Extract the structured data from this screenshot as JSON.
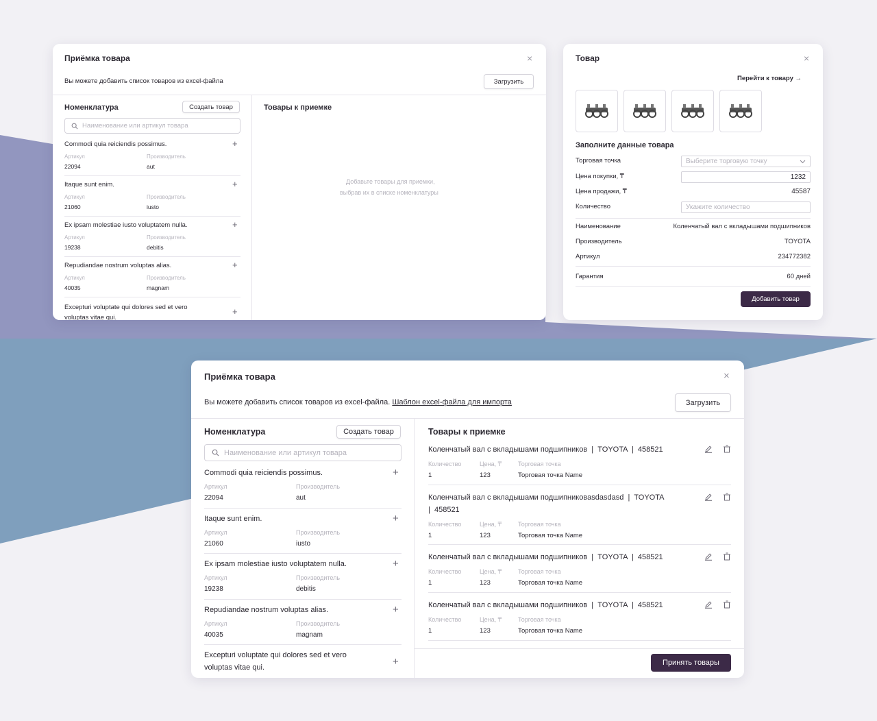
{
  "colors": {
    "background": "#f2f1f5",
    "band_purple": "#9296bf",
    "band_blue": "#7f9fbd",
    "accent": "#3c2a47"
  },
  "modal_small": {
    "title": "Приёмка товара",
    "close": "×",
    "upload_text": "Вы можете добавить список товаров из excel-файла",
    "upload_button": "Загрузить",
    "nomenclature": {
      "title": "Номенклатура",
      "create_button": "Создать товар",
      "search_placeholder": "Наименование или артикул товара",
      "article_label": "Артикул",
      "maker_label": "Производитель",
      "items": [
        {
          "name": "Commodi quia reiciendis possimus.",
          "article": "22094",
          "maker": "aut"
        },
        {
          "name": "Itaque sunt enim.",
          "article": "21060",
          "maker": "iusto"
        },
        {
          "name": "Ex ipsam molestiae iusto voluptatem nulla.",
          "article": "19238",
          "maker": "debitis"
        },
        {
          "name": "Repudiandae nostrum voluptas alias.",
          "article": "40035",
          "maker": "magnam"
        },
        {
          "name": "Excepturi voluptate qui dolores sed et vero voluptas vitae qui."
        }
      ]
    },
    "accept": {
      "title": "Товары к приемке",
      "empty_line1": "Добавьте товары для приемки,",
      "empty_line2": "выбрав их в списке номенклатуры"
    }
  },
  "product_modal": {
    "title": "Товар",
    "close": "×",
    "go_link": "Перейти к товару",
    "go_arrow": "→",
    "thumbnails": [
      "engine-part-image",
      "engine-part-image",
      "engine-part-image",
      "engine-part-image"
    ],
    "form_title": "Заполните данные товара",
    "fields": {
      "point_label": "Торговая точка",
      "point_placeholder": "Выберите торговую точку",
      "buy_label": "Цена покупки, ₸",
      "buy_value": "1232",
      "sell_label": "Цена продажи, ₸",
      "sell_value": "45587",
      "qty_label": "Количество",
      "qty_placeholder": "Укажите количество"
    },
    "info": {
      "name_label": "Наименование",
      "name_value": "Коленчатый вал с вкладышами подшипников",
      "maker_label": "Производитель",
      "maker_value": "TOYOTA",
      "article_label": "Артикул",
      "article_value": "234772382",
      "warranty_label": "Гарантия",
      "warranty_value": "60 дней"
    },
    "add_button": "Добавить товар"
  },
  "modal_large": {
    "title": "Приёмка товара",
    "close": "×",
    "upload_text": "Вы можете добавить список товаров из excel-файла.",
    "template_link": "Шаблон excel-файла для импорта",
    "upload_button": "Загрузить",
    "nomenclature": {
      "title": "Номенклатура",
      "create_button": "Создать товар",
      "search_placeholder": "Наименование или артикул товара",
      "article_label": "Артикул",
      "maker_label": "Производитель",
      "items": [
        {
          "name": "Commodi quia reiciendis possimus.",
          "article": "22094",
          "maker": "aut"
        },
        {
          "name": "Itaque sunt enim.",
          "article": "21060",
          "maker": "iusto"
        },
        {
          "name": "Ex ipsam molestiae iusto voluptatem nulla.",
          "article": "19238",
          "maker": "debitis"
        },
        {
          "name": "Repudiandae nostrum voluptas alias.",
          "article": "40035",
          "maker": "magnam"
        },
        {
          "name": "Excepturi voluptate qui dolores sed et vero",
          "name2": "voluptas vitae qui."
        }
      ]
    },
    "accept": {
      "title": "Товары к приемке",
      "qty_label": "Количество",
      "price_label": "Цена, ₸",
      "point_label": "Торговая точка",
      "items": [
        {
          "title": "Коленчатый вал с вкладышами подшипников  |  TOYOTA  |  458521",
          "qty": "1",
          "price": "123",
          "point": "Торговая точка Name"
        },
        {
          "title": "Коленчатый вал с вкладышами подшипниковasdasdasd  |  TOYOTA",
          "title2": "|  458521",
          "qty": "1",
          "price": "123",
          "point": "Торговая точка Name"
        },
        {
          "title": "Коленчатый вал с вкладышами подшипников  |  TOYOTA  |  458521",
          "qty": "1",
          "price": "123",
          "point": "Торговая точка Name"
        },
        {
          "title": "Коленчатый вал с вкладышами подшипников  |  TOYOTA  |  458521",
          "qty": "1",
          "price": "123",
          "point": "Торговая точка Name"
        }
      ],
      "submit_button": "Принять товары"
    }
  }
}
